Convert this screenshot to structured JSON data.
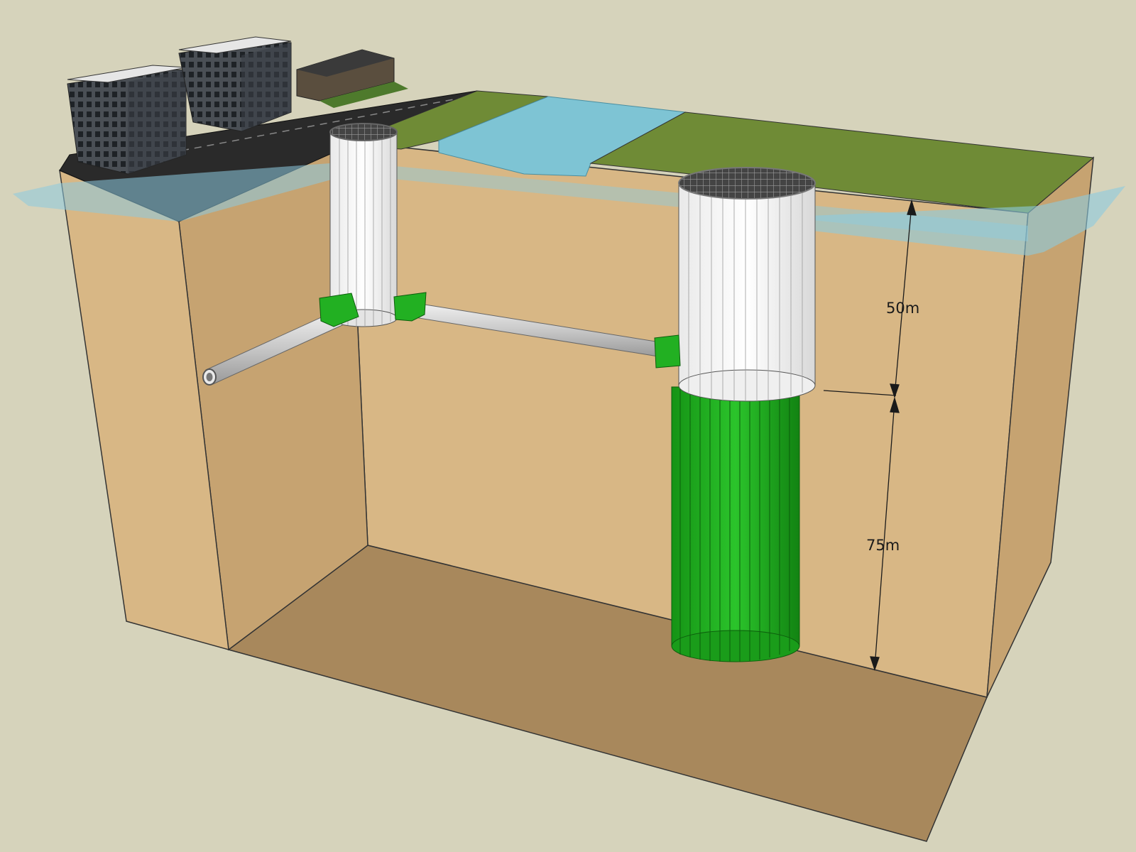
{
  "diagram": {
    "background_color": "#d6d3bb",
    "colors": {
      "soil_face": "#d8b785",
      "soil_side": "#c6a371",
      "soil_floor": "#a8885c",
      "grass": "#6f8b36",
      "water": "#7ec4d4",
      "groundwater": "#8ccbe0",
      "road": "#2a2a2a",
      "shaft_concrete": "#f2f2f2",
      "shaft_green": "#1fa81f",
      "pipe": "#c9c9c9"
    },
    "components": [
      {
        "id": "buildings",
        "icon": "building-icon"
      },
      {
        "id": "road",
        "icon": "road-icon"
      },
      {
        "id": "river",
        "icon": "water-icon"
      },
      {
        "id": "groundwater-table",
        "icon": "water-layer-icon"
      },
      {
        "id": "small-shaft",
        "icon": "shaft-icon"
      },
      {
        "id": "large-shaft",
        "icon": "shaft-icon"
      },
      {
        "id": "tunnel-pipes",
        "icon": "pipe-icon"
      }
    ],
    "dimensions": {
      "upper_depth": "50m",
      "lower_depth": "75m"
    }
  }
}
